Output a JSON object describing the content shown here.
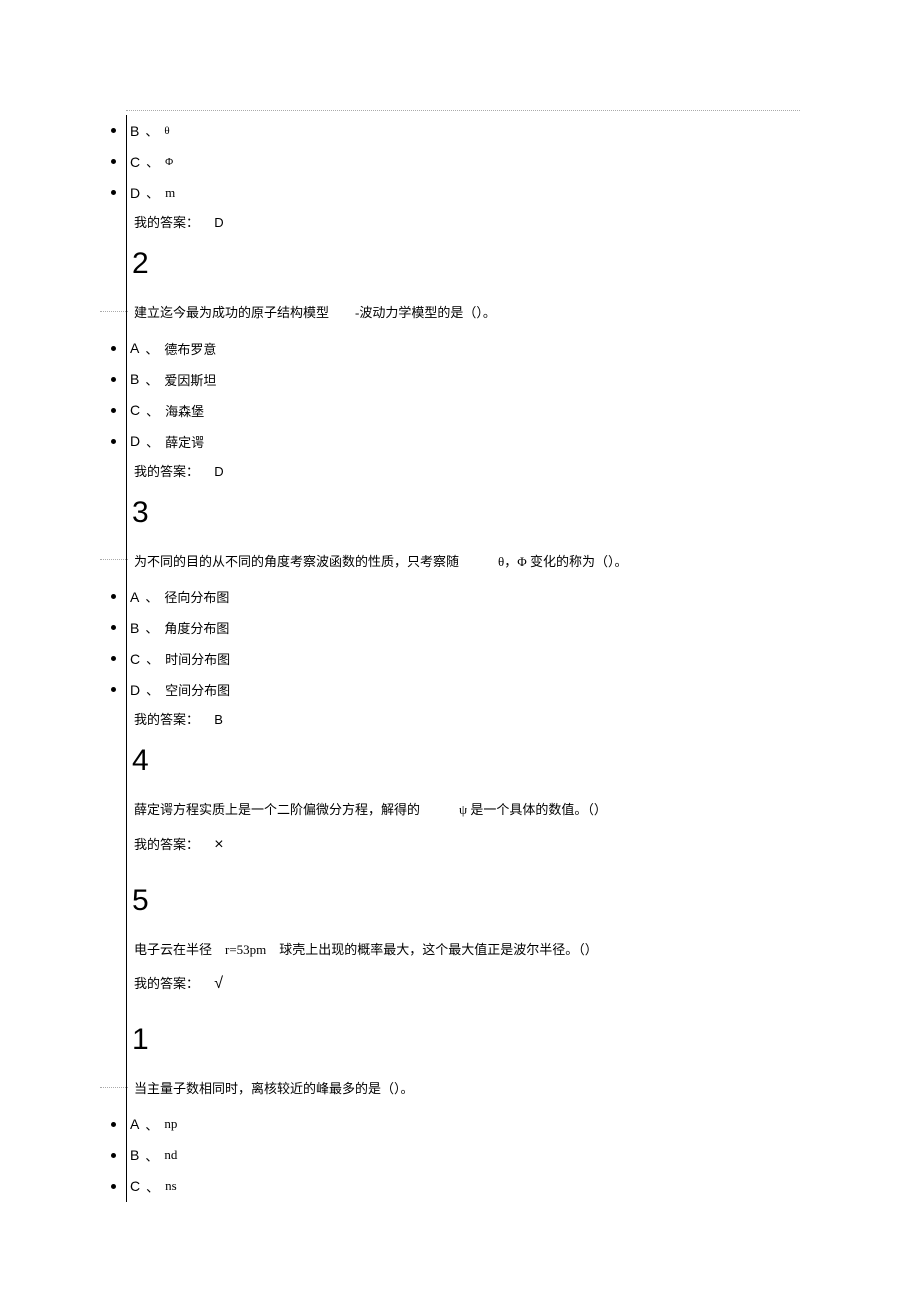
{
  "top_options": [
    {
      "label": "B",
      "text": "θ"
    },
    {
      "label": "C",
      "text": "Φ"
    },
    {
      "label": "D",
      "text": "m"
    }
  ],
  "top_answer_label": "我的答案：",
  "top_answer_value": "D",
  "q2": {
    "num": "2",
    "text": "建立迄今最为成功的原子结构模型　　-波动力学模型的是（）。",
    "options": [
      {
        "label": "A",
        "text": "德布罗意"
      },
      {
        "label": "B",
        "text": "爱因斯坦"
      },
      {
        "label": "C",
        "text": "海森堡"
      },
      {
        "label": "D",
        "text": "薛定谔"
      }
    ],
    "answer_label": "我的答案：",
    "answer_value": "D"
  },
  "q3": {
    "num": "3",
    "text": "为不同的目的从不同的角度考察波函数的性质，只考察随　　　θ，Φ 变化的称为（）。",
    "options": [
      {
        "label": "A",
        "text": "径向分布图"
      },
      {
        "label": "B",
        "text": "角度分布图"
      },
      {
        "label": "C",
        "text": "时间分布图"
      },
      {
        "label": "D",
        "text": "空间分布图"
      }
    ],
    "answer_label": "我的答案：",
    "answer_value": "B"
  },
  "q4": {
    "num": "4",
    "text": "薛定谔方程实质上是一个二阶偏微分方程，解得的　　　ψ 是一个具体的数值。（）",
    "answer_label": "我的答案：",
    "answer_symbol": "×"
  },
  "q5": {
    "num": "5",
    "text": "电子云在半径　r=53pm　球壳上出现的概率最大，这个最大值正是波尔半径。（）",
    "answer_label": "我的答案：",
    "answer_symbol": "√"
  },
  "q1b": {
    "num": "1",
    "text": "当主量子数相同时，离核较近的峰最多的是（）。",
    "options": [
      {
        "label": "A",
        "text": "np"
      },
      {
        "label": "B",
        "text": "nd"
      },
      {
        "label": "C",
        "text": "ns"
      }
    ]
  }
}
